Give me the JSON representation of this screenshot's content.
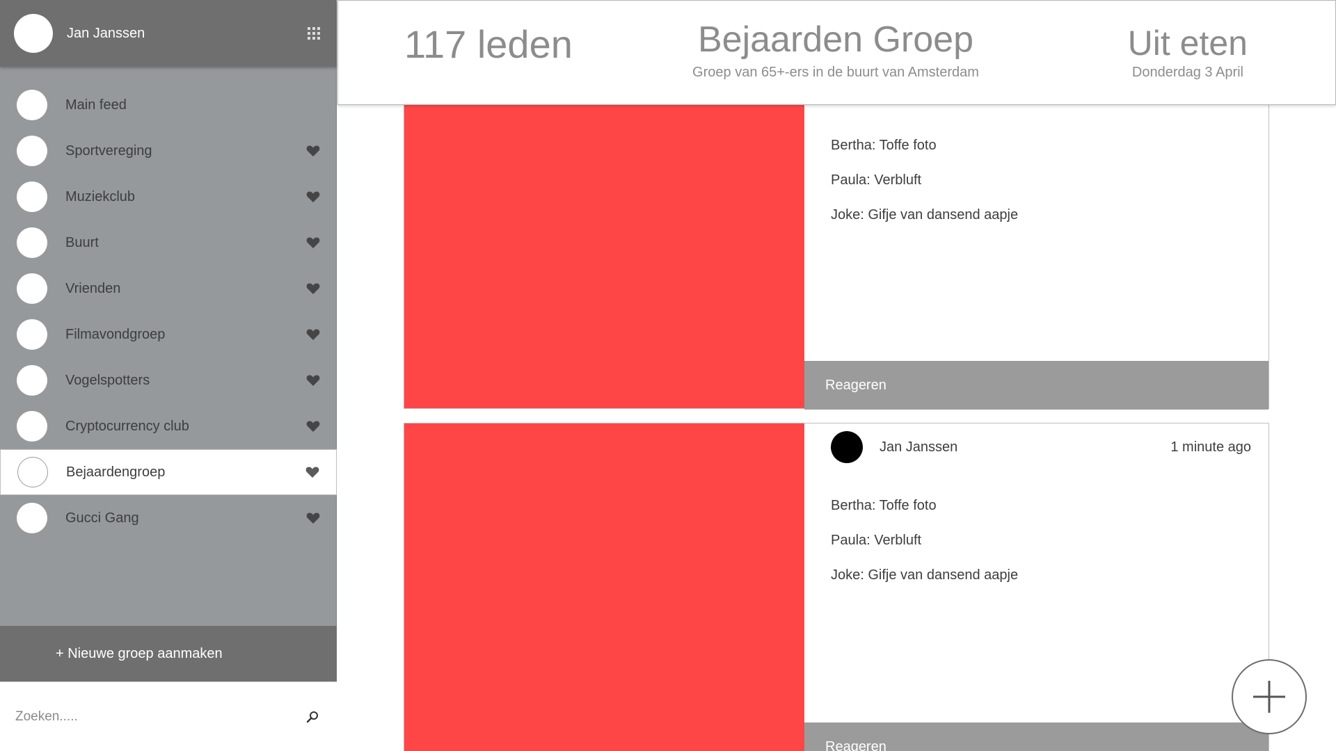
{
  "profile": {
    "name": "Jan Janssen"
  },
  "sidebar": {
    "groups": [
      {
        "label": "Main feed",
        "favorite": false,
        "active": false
      },
      {
        "label": "Sportvereging",
        "favorite": true,
        "active": false
      },
      {
        "label": "Muziekclub",
        "favorite": true,
        "active": false
      },
      {
        "label": "Buurt",
        "favorite": true,
        "active": false
      },
      {
        "label": "Vrienden",
        "favorite": true,
        "active": false
      },
      {
        "label": "Filmavondgroep",
        "favorite": true,
        "active": false
      },
      {
        "label": "Vogelspotters",
        "favorite": true,
        "active": false
      },
      {
        "label": "Cryptocurrency club",
        "favorite": true,
        "active": false
      },
      {
        "label": "Bejaardengroep",
        "favorite": true,
        "active": true
      },
      {
        "label": "Gucci Gang",
        "favorite": true,
        "active": false
      }
    ],
    "new_group_label": "+ Nieuwe groep aanmaken",
    "search_placeholder": "Zoeken....."
  },
  "header": {
    "members": "117 leden",
    "group_title": "Bejaarden Groep",
    "group_subtitle": "Groep van 65+-ers in de buurt van Amsterdam",
    "event_title": "Uit eten",
    "event_date": "Donderdag 3 April"
  },
  "posts": [
    {
      "author": "",
      "time": "",
      "comments": [
        "Bertha: Toffe foto",
        "Paula: Verbluft",
        "Joke: Gifje van dansend aapje"
      ],
      "reply_label": "Reageren"
    },
    {
      "author": "Jan Janssen",
      "time": "1 minute ago",
      "comments": [
        "Bertha: Toffe foto",
        "Paula: Verbluft",
        "Joke: Gifje van dansend aapje"
      ],
      "reply_label": "Reageren"
    }
  ],
  "colors": {
    "sidebar_bg": "#95999c",
    "bar_dark": "#6f6f6f",
    "post_image": "#ff4646",
    "reply_bar": "#9b9b9b"
  },
  "icons": {
    "apps": "grid-icon",
    "favorite": "heart-icon",
    "search": "search-icon",
    "add_post": "plus-icon"
  }
}
